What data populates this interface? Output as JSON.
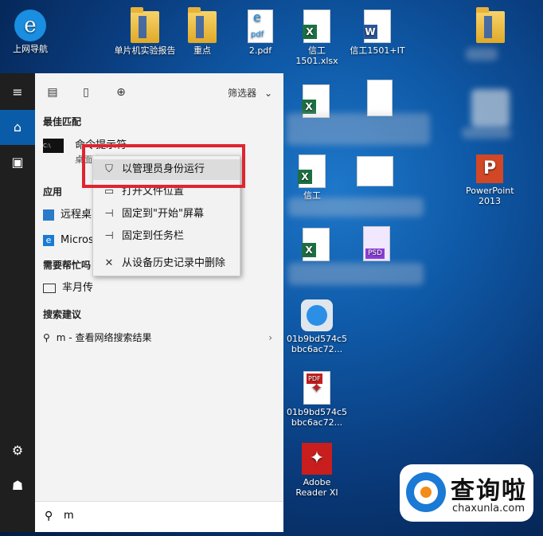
{
  "desktop": {
    "icons": [
      {
        "label": "上网导航",
        "kind": "ie"
      },
      {
        "label": "单片机实验报告",
        "kind": "folder"
      },
      {
        "label": "重点",
        "kind": "folder"
      },
      {
        "label": "2.pdf",
        "kind": "pdf-edge"
      },
      {
        "label": "信工1501.xlsx",
        "kind": "excel"
      },
      {
        "label": "信工1501+IT",
        "kind": "word"
      },
      {
        "label": "PowerPoint 2013",
        "kind": "powerpoint"
      },
      {
        "label": "01b9bd574c5bbc6ac72...",
        "kind": "safari"
      },
      {
        "label": "01b9bd574c5bbc6ac72...",
        "kind": "pdf"
      },
      {
        "label": "Adobe Reader XI",
        "kind": "adobe"
      },
      {
        "label": "信工",
        "kind": "excel"
      },
      {
        "label": "PSD",
        "kind": "psd"
      }
    ]
  },
  "start_menu": {
    "filter_label": "筛选器",
    "best_match_title": "最佳匹配",
    "best_match_app": "命令提示符",
    "best_match_sub": "桌面应用",
    "apps_title": "应用",
    "apps": [
      "远程桌面连接",
      "Microsoft Edge"
    ],
    "help_title": "需要帮忙吗",
    "help_item": "芈月传",
    "suggest_title": "搜索建议",
    "suggest_item": "m - 查看网络搜索结果",
    "search_value": "m"
  },
  "context_menu": {
    "items": [
      "以管理员身份运行",
      "打开文件位置",
      "固定到\"开始\"屏幕",
      "固定到任务栏",
      "从设备历史记录中删除"
    ]
  },
  "watermark": {
    "cn": "查询啦",
    "en": "chaxunla.com"
  },
  "colors": {
    "accent": "#0a5ca8",
    "highlight_box": "#e0242f",
    "watermark_blue": "#1a7ad4"
  }
}
